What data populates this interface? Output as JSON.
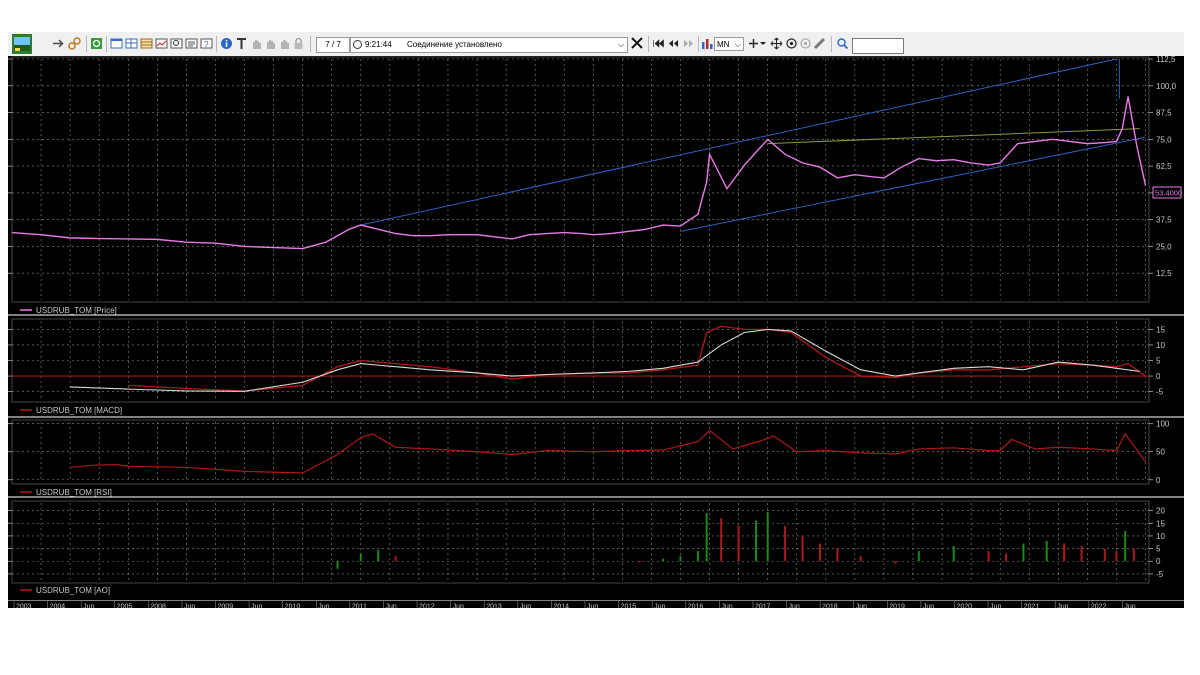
{
  "toolbar": {
    "counter": "7 / 7",
    "status_time": "9:21:44",
    "status_message": "Соединение установлено",
    "interval": "MN"
  },
  "price_axis": [
    "112,5",
    "100,0",
    "87,5",
    "75,0",
    "62,5",
    "50,0",
    "37,5",
    "25,0",
    "12,5"
  ],
  "macd_axis": [
    "15",
    "10",
    "5",
    "0",
    "-5"
  ],
  "rsi_axis": [
    "100",
    "50",
    "0"
  ],
  "ao_axis": [
    "20",
    "15",
    "10",
    "5",
    "0",
    "-5"
  ],
  "panels": {
    "price_legend": "USDRUB_TOM [Price]",
    "macd_legend": "USDRUB_TOM [MACD]",
    "rsi_legend": "USDRUB_TOM [RSI]",
    "ao_legend": "USDRUB_TOM [AO]",
    "last_price": "53.4000"
  },
  "time_axis": [
    "2003",
    "2004",
    "Jun",
    "2005",
    "2008",
    "Jun",
    "2009",
    "Jun",
    "2010",
    "Jun",
    "2011",
    "Jun",
    "2012",
    "Jun",
    "2013",
    "Jun",
    "2014",
    "Jun",
    "2015",
    "Jun",
    "2016",
    "Jun",
    "2017",
    "Jun",
    "2018",
    "Jun",
    "2019",
    "Jun",
    "2020",
    "Jun",
    "2021",
    "Jun",
    "2022",
    "Jun"
  ],
  "colors": {
    "background": "#000000",
    "price_line": "#e87be8",
    "channel_line": "#2f5fc4",
    "trend_line": "#8e9a3a",
    "macd_line": "#d8d8d8",
    "signal_line": "#b01818",
    "zero_line": "#b01818",
    "rsi_line": "#b01818",
    "ao_up": "#1a8a1a",
    "ao_down": "#b01818",
    "grid": "#8c8c8c",
    "axis_text": "#c8c8c8"
  },
  "chart_data": [
    {
      "type": "line",
      "title": "USDRUB_TOM [Price]",
      "ylim": [
        0,
        112.5
      ],
      "x": [
        2003.0,
        2003.5,
        2004.0,
        2004.5,
        2005.0,
        2005.5,
        2006.0,
        2006.5,
        2007.0,
        2007.5,
        2008.0,
        2008.4,
        2008.8,
        2009.0,
        2009.3,
        2009.6,
        2009.9,
        2010.2,
        2010.5,
        2010.8,
        2011.0,
        2011.3,
        2011.6,
        2011.9,
        2012.2,
        2012.5,
        2012.8,
        2013.0,
        2013.3,
        2013.6,
        2013.9,
        2014.2,
        2014.5,
        2014.8,
        2014.95,
        2015.0,
        2015.3,
        2015.6,
        2015.9,
        2016.0,
        2016.3,
        2016.6,
        2016.9,
        2017.2,
        2017.5,
        2017.8,
        2018.0,
        2018.3,
        2018.6,
        2018.9,
        2019.2,
        2019.5,
        2019.8,
        2020.0,
        2020.3,
        2020.6,
        2020.9,
        2021.2,
        2021.5,
        2021.8,
        2022.0,
        2022.1,
        2022.2,
        2022.35,
        2022.5
      ],
      "y": [
        31.5,
        30.5,
        29.0,
        28.7,
        28.5,
        28.3,
        27.0,
        26.5,
        25.0,
        24.5,
        24.0,
        27.0,
        33.0,
        35.0,
        33.0,
        31.0,
        30.0,
        30.0,
        30.5,
        30.5,
        30.5,
        29.5,
        28.5,
        30.5,
        31.0,
        31.5,
        31.0,
        30.5,
        31.0,
        32.0,
        33.0,
        35.0,
        34.5,
        40.0,
        55.0,
        68.0,
        52.0,
        63.0,
        72.0,
        75.0,
        68.0,
        64.0,
        62.0,
        57.0,
        58.5,
        57.5,
        57.0,
        62.0,
        66.0,
        65.0,
        65.5,
        64.0,
        63.0,
        64.0,
        73.0,
        74.0,
        75.0,
        74.0,
        73.0,
        73.5,
        74.0,
        80.0,
        95.0,
        72.0,
        53.4
      ]
    },
    {
      "type": "line",
      "title": "USDRUB_TOM [MACD]",
      "ylim": [
        -5,
        15
      ],
      "series": [
        {
          "x": [
            2004.0,
            2005.0,
            2006.0,
            2007.0,
            2008.0,
            2008.6,
            2009.0,
            2009.6,
            2010.2,
            2011.0,
            2011.6,
            2012.2,
            2013.0,
            2013.6,
            2014.2,
            2014.8,
            2015.2,
            2015.6,
            2016.0,
            2016.4,
            2017.0,
            2017.6,
            2018.2,
            2018.6,
            2019.2,
            2019.8,
            2020.4,
            2021.0,
            2021.6,
            2022.0,
            2022.4
          ],
          "y": [
            -3.5,
            -4.2,
            -4.8,
            -4.9,
            -2.0,
            2.0,
            4.0,
            3.0,
            2.0,
            1.0,
            0.0,
            0.5,
            1.0,
            1.5,
            2.5,
            4.5,
            10.0,
            14.0,
            15.0,
            14.5,
            8.0,
            2.0,
            0.0,
            1.0,
            2.5,
            3.0,
            2.0,
            4.5,
            3.5,
            2.5,
            1.5
          ]
        },
        {
          "x": [
            2005.0,
            2006.0,
            2007.0,
            2008.0,
            2008.6,
            2009.0,
            2009.6,
            2010.2,
            2011.0,
            2011.6,
            2012.2,
            2013.0,
            2013.6,
            2014.2,
            2014.8,
            2014.95,
            2015.2,
            2015.6,
            2016.0,
            2016.4,
            2017.0,
            2017.6,
            2018.2,
            2018.6,
            2019.2,
            2019.8,
            2020.4,
            2021.0,
            2021.6,
            2022.0,
            2022.2,
            2022.5
          ],
          "y": [
            -3.0,
            -4.0,
            -4.8,
            -3.0,
            3.0,
            5.0,
            4.0,
            3.0,
            1.0,
            -1.0,
            0.5,
            1.0,
            1.0,
            2.0,
            3.5,
            14.0,
            16.0,
            15.0,
            15.0,
            14.0,
            6.0,
            0.0,
            -0.5,
            1.0,
            2.0,
            2.0,
            3.0,
            4.0,
            3.5,
            3.0,
            4.0,
            0.0
          ]
        }
      ]
    },
    {
      "type": "line",
      "title": "USDRUB_TOM [RSI]",
      "ylim": [
        0,
        100
      ],
      "x": [
        2004.0,
        2004.4,
        2004.8,
        2005.0,
        2006.0,
        2007.0,
        2008.0,
        2008.6,
        2009.0,
        2009.2,
        2009.6,
        2010.2,
        2011.0,
        2011.6,
        2012.2,
        2013.0,
        2013.6,
        2014.2,
        2014.8,
        2015.0,
        2015.4,
        2015.9,
        2016.1,
        2016.5,
        2017.0,
        2017.6,
        2018.2,
        2018.6,
        2019.2,
        2019.8,
        2020.0,
        2020.2,
        2020.6,
        2021.0,
        2021.6,
        2022.0,
        2022.15,
        2022.5
      ],
      "y": [
        22,
        26,
        27,
        24,
        22,
        15,
        12,
        45,
        75,
        82,
        58,
        55,
        50,
        45,
        52,
        50,
        52,
        53,
        68,
        88,
        55,
        70,
        78,
        50,
        52,
        48,
        46,
        55,
        57,
        52,
        52,
        72,
        55,
        58,
        55,
        52,
        82,
        32
      ]
    },
    {
      "type": "bar",
      "title": "USDRUB_TOM [AO]",
      "ylim": [
        -5,
        20
      ],
      "x": [
        2008.6,
        2009.0,
        2009.3,
        2009.6,
        2013.8,
        2014.2,
        2014.5,
        2014.8,
        2014.95,
        2015.2,
        2015.5,
        2015.8,
        2016.0,
        2016.3,
        2016.6,
        2016.9,
        2017.2,
        2017.6,
        2018.2,
        2018.6,
        2019.2,
        2019.8,
        2020.1,
        2020.4,
        2020.8,
        2021.1,
        2021.4,
        2021.8,
        2022.0,
        2022.15,
        2022.3
      ],
      "y": [
        -3.0,
        3.0,
        4.5,
        2.0,
        -0.5,
        1.0,
        2.0,
        4.0,
        19.0,
        17.0,
        14.0,
        16.0,
        19.5,
        14.0,
        10.0,
        7.0,
        5.0,
        2.0,
        -1.0,
        4.0,
        6.0,
        4.0,
        3.0,
        7.0,
        8.0,
        7.0,
        6.0,
        5.0,
        4.0,
        12.0,
        5.0
      ]
    }
  ]
}
